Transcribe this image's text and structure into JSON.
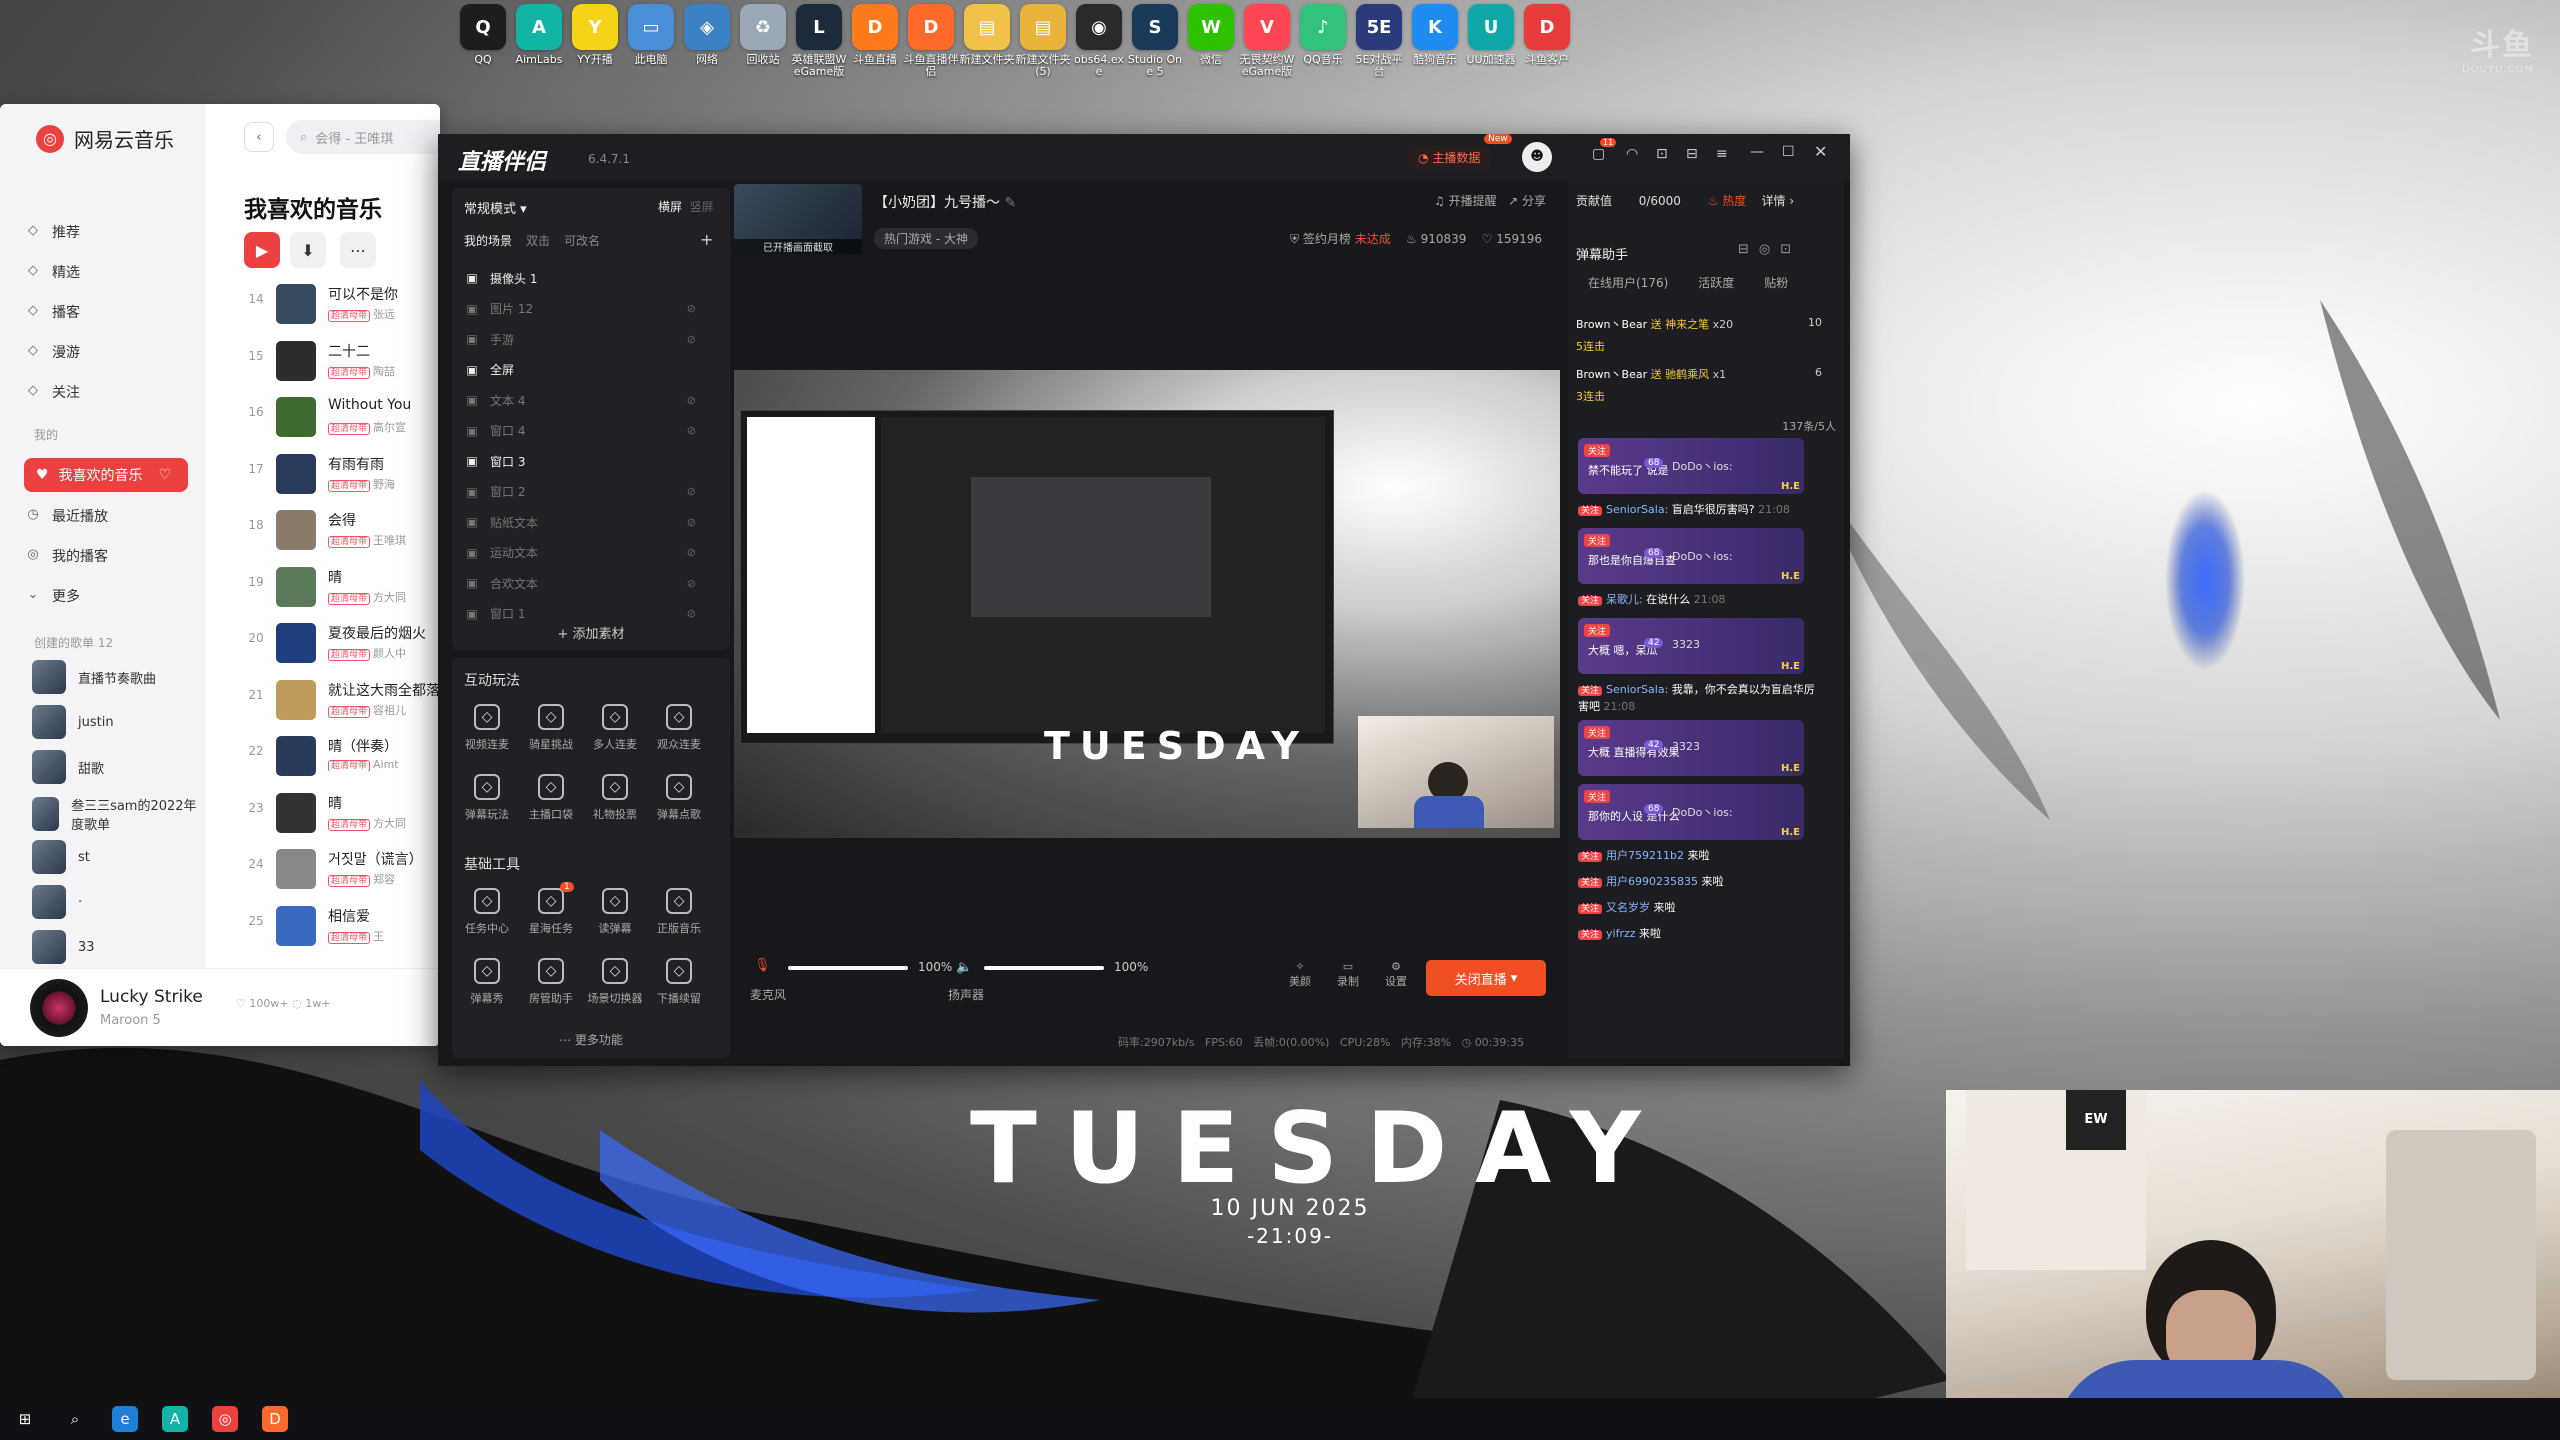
{
  "desktop": {
    "watermark": "斗鱼",
    "watermark_sub": "DOUYU.COM",
    "icons": [
      {
        "label": "QQ",
        "icon": "qq-icon",
        "color": "#1d1d1d",
        "glyph": "Q"
      },
      {
        "label": "AimLabs",
        "icon": "aimlabs-icon",
        "color": "#12b5a5",
        "glyph": "A"
      },
      {
        "label": "YY开播",
        "icon": "yy-icon",
        "color": "#f5d316",
        "glyph": "Y"
      },
      {
        "label": "此电脑",
        "icon": "computer-icon",
        "color": "#4a90d9",
        "glyph": "▭"
      },
      {
        "label": "网络",
        "icon": "network-icon",
        "color": "#3b82c4",
        "glyph": "◈"
      },
      {
        "label": "回收站",
        "icon": "recycle-bin-icon",
        "color": "#9aa8b6",
        "glyph": "♻"
      },
      {
        "label": "英雄联盟WeGame版",
        "icon": "lol-icon",
        "color": "#1b2b3a",
        "glyph": "L"
      },
      {
        "label": "斗鱼直播",
        "icon": "douyu-icon",
        "color": "#ff7a1a",
        "glyph": "D"
      },
      {
        "label": "斗鱼直播伴侣",
        "icon": "douyu-companion-icon",
        "color": "#ff6a2a",
        "glyph": "D"
      },
      {
        "label": "新建文件夹",
        "icon": "folder-icon",
        "color": "#f1c24a",
        "glyph": "▤"
      },
      {
        "label": "新建文件夹(5)",
        "icon": "folder-icon-2",
        "color": "#e9b43a",
        "glyph": "▤"
      },
      {
        "label": "obs64.exe",
        "icon": "obs-icon",
        "color": "#2a2a2a",
        "glyph": "◉"
      },
      {
        "label": "Studio One 5",
        "icon": "studio-one-icon",
        "color": "#1a3a5a",
        "glyph": "S"
      },
      {
        "label": "微信",
        "icon": "wechat-icon",
        "color": "#2dc100",
        "glyph": "W"
      },
      {
        "label": "无畏契约WeGame版",
        "icon": "valorant-icon",
        "color": "#ff4655",
        "glyph": "V"
      },
      {
        "label": "QQ音乐",
        "icon": "qq-music-icon",
        "color": "#31c27c",
        "glyph": "♪"
      },
      {
        "label": "5E对战平台",
        "icon": "5e-icon",
        "color": "#2a3a7a",
        "glyph": "5E"
      },
      {
        "label": "酷狗音乐",
        "icon": "kugou-icon",
        "color": "#1e8cf0",
        "glyph": "K"
      },
      {
        "label": "UU加速器",
        "icon": "uu-icon",
        "color": "#0fa7a7",
        "glyph": "U"
      },
      {
        "label": "斗鱼客户",
        "icon": "douyu-client-icon",
        "color": "#e83c3c",
        "glyph": "D"
      }
    ]
  },
  "wallpaper": {
    "title": "TUESDAY",
    "date": "10 JUN 2025",
    "time": "-21:09-"
  },
  "netease": {
    "app_name": "网易云音乐",
    "search_placeholder": "会得 - 王唯琪",
    "nav": [
      {
        "label": "推荐",
        "icon": "recommend-icon"
      },
      {
        "label": "精选",
        "icon": "featured-icon"
      },
      {
        "label": "播客",
        "icon": "podcast-icon"
      },
      {
        "label": "漫游",
        "icon": "roam-icon"
      },
      {
        "label": "关注",
        "icon": "follow-icon"
      }
    ],
    "my_label": "我的",
    "fav_label": "我喜欢的音乐",
    "my_items": [
      "最近播放",
      "我的播客",
      "更多"
    ],
    "created_label": "创建的歌单 12",
    "playlists": [
      "直播节奏歌曲",
      "justin",
      "甜歌",
      "叁三三sam的2022年度歌单",
      "st",
      "·",
      "33"
    ],
    "page_title": "我喜欢的音乐",
    "songs": [
      {
        "no": "14",
        "title": "可以不是你",
        "artist": "张远"
      },
      {
        "no": "15",
        "title": "二十二",
        "artist": "陶喆"
      },
      {
        "no": "16",
        "title": "Without You",
        "artist": "高尔宣"
      },
      {
        "no": "17",
        "title": "有雨有雨",
        "artist": "野海"
      },
      {
        "no": "18",
        "title": "会得",
        "artist": "王唯琪"
      },
      {
        "no": "19",
        "title": "晴",
        "artist": "方大同"
      },
      {
        "no": "20",
        "title": "夏夜最后的烟火",
        "artist": "颜人中"
      },
      {
        "no": "21",
        "title": "就让这大雨全都落下",
        "artist": "容祖儿"
      },
      {
        "no": "22",
        "title": "晴（伴奏）",
        "artist": "Aimt"
      },
      {
        "no": "23",
        "title": "晴",
        "artist": "方大同"
      },
      {
        "no": "24",
        "title": "거짓말（谎言）",
        "artist": "郑容"
      },
      {
        "no": "25",
        "title": "相信爱",
        "artist": "王"
      }
    ],
    "vip_tag": "超清母带",
    "player": {
      "song": "Lucky Strike",
      "artist": "Maroon 5",
      "likes": "100w+",
      "comments": "1w+"
    }
  },
  "stream": {
    "logo": "直播伴侣",
    "version": "6.4.7.1",
    "host_data": "主播数据",
    "new_badge": "New",
    "notice_count": "11",
    "mode": "常规模式",
    "orientation": [
      "横屏",
      "竖屏"
    ],
    "scene_tabs": [
      "我的场景",
      "双击",
      "可改名"
    ],
    "sources": [
      {
        "label": "摄像头 1",
        "on": true
      },
      {
        "label": "图片 12",
        "on": false
      },
      {
        "label": "手游",
        "on": false
      },
      {
        "label": "全屏",
        "on": true
      },
      {
        "label": "文本 4",
        "on": false
      },
      {
        "label": "窗口 4",
        "on": false
      },
      {
        "label": "窗口 3",
        "on": true
      },
      {
        "label": "窗口 2",
        "on": false
      },
      {
        "label": "贴纸文本",
        "on": false
      },
      {
        "label": "运动文本",
        "on": false
      },
      {
        "label": "合欢文本",
        "on": false
      },
      {
        "label": "窗口 1",
        "on": false
      }
    ],
    "add_material": "添加素材",
    "interactive_title": "互动玩法",
    "interactive": [
      "视频连麦",
      "骑星挑战",
      "多人连麦",
      "观众连麦",
      "弹幕玩法",
      "主播口袋",
      "礼物投票",
      "弹幕点歌"
    ],
    "basic_title": "基础工具",
    "basic": [
      "任务中心",
      "星海任务",
      "读弹幕",
      "正版音乐",
      "弹幕秀",
      "房管助手",
      "场景切换器",
      "下播续留"
    ],
    "task_badge": "1",
    "more_func": "更多功能",
    "room_title": "【小奶团】九号播～",
    "cover_caption": "已开播画面截取",
    "category": "热门游戏 - 大神",
    "actions": [
      "开播提醒",
      "分享"
    ],
    "sign_monthly": "签约月榜",
    "sign_status": "未达成",
    "heat": "910839",
    "likes": "159196",
    "mic_label": "麦克风",
    "mic_vol": "100%",
    "mic_level": 1.0,
    "speaker_label": "扬声器",
    "speaker_vol": "100%",
    "speaker_level": 1.0,
    "controls": [
      "美颜",
      "录制",
      "设置"
    ],
    "close_live": "关闭直播",
    "status": {
      "bitrate": "码率:2907kb/s",
      "fps": "FPS:60",
      "drop": "丢帧:0(0.00%)",
      "cpu": "CPU:28%",
      "mem": "内存:38%",
      "time": "00:39:35"
    },
    "contrib_label": "贡献值",
    "contrib_value": "0/6000",
    "hot_label": "热度",
    "detail_label": "详情",
    "danmu_title": "弹幕助手",
    "danmu_tabs": [
      "在线用户(176)",
      "活跃度",
      "贴粉"
    ],
    "gifts": [
      {
        "user": "Brown丶Bear",
        "act": "送 神来之笔",
        "count": "x20",
        "extra": "5连击",
        "num": "10"
      },
      {
        "user": "Brown丶Bear",
        "act": "送 驰鹤乘风",
        "count": "x1",
        "extra": "3连击",
        "num": "6"
      }
    ],
    "online": "137条/5人",
    "messages": [
      {
        "type": "card",
        "badge": "关注",
        "name": "DoDo丶ios:",
        "text": "禁不能玩了 说是",
        "level": "68"
      },
      {
        "type": "msg",
        "badge": "关注",
        "name": "SeniorSala:",
        "text": "盲启华很厉害吗?",
        "time": "21:08"
      },
      {
        "type": "card",
        "badge": "关注",
        "name": "DoDo丶ios:",
        "text": "那也是你自爆自查",
        "level": "68"
      },
      {
        "type": "msg",
        "badge": "关注",
        "name": "呆歌儿:",
        "text": "在说什么",
        "time": "21:08"
      },
      {
        "type": "card",
        "badge": "关注",
        "name": "3323",
        "text": "大概 嗯，呆瓜",
        "level": "42"
      },
      {
        "type": "msg",
        "badge": "关注",
        "name": "SeniorSala:",
        "text": "我靠，你不会真以为盲启华厉害吧",
        "time": "21:08"
      },
      {
        "type": "card",
        "badge": "关注",
        "name": "3323",
        "text": "大概 直播得有效果",
        "level": "42"
      },
      {
        "type": "card",
        "badge": "关注",
        "name": "DoDo丶ios:",
        "text": "那你的人设 是什么",
        "level": "68"
      },
      {
        "type": "msg",
        "badge": "关注",
        "name": "用户759211b2",
        "text": "来啦",
        "time": ""
      },
      {
        "type": "msg",
        "badge": "关注",
        "name": "用户6990235835",
        "text": "来啦",
        "time": ""
      },
      {
        "type": "msg",
        "badge": "关注",
        "name": "又名岁岁",
        "text": "来啦",
        "time": ""
      },
      {
        "type": "msg",
        "badge": "关注",
        "name": "yifrzz",
        "text": "来啦",
        "time": ""
      }
    ],
    "he_tag": "H.E"
  },
  "taskbar": [
    {
      "icon": "windows-start-icon",
      "glyph": "⊞"
    },
    {
      "icon": "search-icon",
      "glyph": "⌕"
    },
    {
      "icon": "edge-icon",
      "glyph": "e"
    },
    {
      "icon": "aimlabs-taskbar-icon",
      "glyph": "A"
    },
    {
      "icon": "netease-taskbar-icon",
      "glyph": "◎"
    },
    {
      "icon": "douyu-taskbar-icon",
      "glyph": "D"
    }
  ]
}
